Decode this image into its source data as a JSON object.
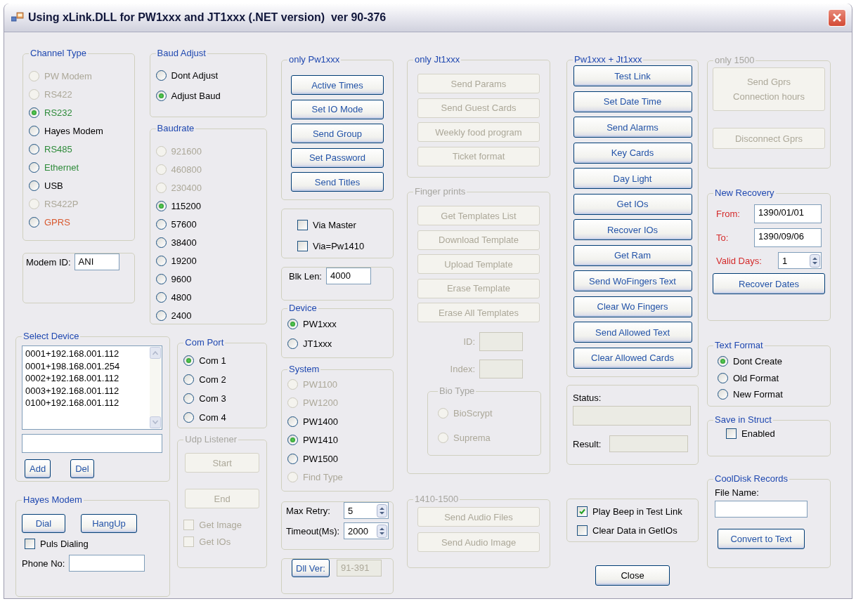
{
  "window": {
    "title": "Using xLink.DLL for PW1xxx and JT1xxx (.NET version)  ver 90-376"
  },
  "channel_type": {
    "title": "Channel Type",
    "options": [
      {
        "label": "PW Modem",
        "selected": false,
        "disabled": true
      },
      {
        "label": "RS422",
        "selected": false,
        "disabled": true
      },
      {
        "label": "RS232",
        "selected": true,
        "disabled": false,
        "color": "#2e8b3a"
      },
      {
        "label": "Hayes Modem",
        "selected": false,
        "disabled": false,
        "color": "#000000"
      },
      {
        "label": "RS485",
        "selected": false,
        "disabled": false,
        "color": "#2e8b3a"
      },
      {
        "label": "Ethernet",
        "selected": false,
        "disabled": false,
        "color": "#2e8b3a"
      },
      {
        "label": "USB",
        "selected": false,
        "disabled": false,
        "color": "#000000"
      },
      {
        "label": "RS422P",
        "selected": false,
        "disabled": true
      },
      {
        "label": "GPRS",
        "selected": false,
        "disabled": false,
        "color": "#d8582e"
      }
    ]
  },
  "modem_id": {
    "label": "Modem ID:",
    "value": "ANI"
  },
  "baud_adjust": {
    "title": "Baud Adjust",
    "options": [
      {
        "label": "Dont Adjust",
        "selected": false
      },
      {
        "label": "Adjust Baud",
        "selected": true
      }
    ]
  },
  "baudrate": {
    "title": "Baudrate",
    "options": [
      {
        "label": "921600",
        "selected": false,
        "disabled": true
      },
      {
        "label": "460800",
        "selected": false,
        "disabled": true
      },
      {
        "label": "230400",
        "selected": false,
        "disabled": true
      },
      {
        "label": "115200",
        "selected": true,
        "disabled": false
      },
      {
        "label": "57600",
        "selected": false,
        "disabled": false
      },
      {
        "label": "38400",
        "selected": false,
        "disabled": false
      },
      {
        "label": "19200",
        "selected": false,
        "disabled": false
      },
      {
        "label": "9600",
        "selected": false,
        "disabled": false
      },
      {
        "label": "4800",
        "selected": false,
        "disabled": false
      },
      {
        "label": "2400",
        "selected": false,
        "disabled": false
      }
    ]
  },
  "select_device": {
    "title": "Select Device",
    "items": [
      "0001+192.168.001.112",
      "0001+198.168.001.254",
      "0002+192.168.001.112",
      "0003+192.168.001.112",
      "0100+192.168.001.112"
    ],
    "buttons": [
      {
        "label": "Add",
        "disabled": false
      },
      {
        "label": "Del",
        "disabled": false
      }
    ]
  },
  "hayes_modem": {
    "title": "Hayes Modem",
    "buttons": [
      {
        "label": "Dial",
        "disabled": false
      },
      {
        "label": "HangUp",
        "disabled": false
      }
    ],
    "puls_dialing": {
      "label": "Puls Dialing",
      "checked": false
    },
    "phone_no": {
      "label": "Phone No:"
    }
  },
  "com_port": {
    "title": "Com Port",
    "options": [
      {
        "label": "Com 1",
        "selected": true
      },
      {
        "label": "Com 2",
        "selected": false
      },
      {
        "label": "Com 3",
        "selected": false
      },
      {
        "label": "Com 4",
        "selected": false
      }
    ]
  },
  "udp_listener": {
    "title": "Udp Listener",
    "disabled": true,
    "buttons": [
      {
        "label": "Start",
        "disabled": true
      },
      {
        "label": "End",
        "disabled": true
      }
    ],
    "checkboxes": [
      {
        "label": "Get Image",
        "checked": false,
        "disabled": true
      },
      {
        "label": "Get IOs",
        "checked": false,
        "disabled": true
      }
    ]
  },
  "only_pw1xxx": {
    "title": "only Pw1xxx",
    "buttons": [
      {
        "label": "Active Times",
        "disabled": false
      },
      {
        "label": "Set IO Mode",
        "disabled": false
      },
      {
        "label": "Send Group",
        "disabled": false
      },
      {
        "label": "Set Password",
        "disabled": false
      },
      {
        "label": "Send Titles",
        "disabled": false
      }
    ]
  },
  "via": {
    "checkboxes": [
      {
        "label": "Via Master",
        "checked": false
      },
      {
        "label": "Via=Pw1410",
        "checked": false
      }
    ]
  },
  "blk_len": {
    "label": "Blk Len:",
    "value": "4000"
  },
  "device": {
    "title": "Device",
    "options": [
      {
        "label": "PW1xxx",
        "selected": true
      },
      {
        "label": "JT1xxx",
        "selected": false
      }
    ]
  },
  "system": {
    "title": "System",
    "options": [
      {
        "label": "PW1100",
        "selected": false,
        "disabled": true
      },
      {
        "label": "PW1200",
        "selected": false,
        "disabled": true
      },
      {
        "label": "PW1400",
        "selected": false,
        "disabled": false
      },
      {
        "label": "PW1410",
        "selected": true,
        "disabled": false
      },
      {
        "label": "PW1500",
        "selected": false,
        "disabled": false
      },
      {
        "label": "Find Type",
        "selected": false,
        "disabled": true
      }
    ]
  },
  "retry": {
    "fields": [
      {
        "label": "Max Retry:",
        "value": "5"
      },
      {
        "label": "Timeout(Ms):",
        "value": "2000"
      }
    ]
  },
  "dll_ver": {
    "button": {
      "label": "Dll Ver:",
      "disabled": false
    },
    "value": "91-391"
  },
  "only_jt1xxx": {
    "title": "only Jt1xxx",
    "buttons": [
      {
        "label": "Send Params",
        "disabled": true
      },
      {
        "label": "Send Guest Cards",
        "disabled": true
      },
      {
        "label": "Weekly food program",
        "disabled": true
      },
      {
        "label": "Ticket format",
        "disabled": true
      }
    ]
  },
  "finger_prints": {
    "title": "Finger prints",
    "disabled": true,
    "buttons": [
      {
        "label": "Get Templates List",
        "disabled": true
      },
      {
        "label": "Download Template",
        "disabled": true
      },
      {
        "label": "Upload Template",
        "disabled": true
      },
      {
        "label": "Erase Template",
        "disabled": true
      },
      {
        "label": "Erase All Templates",
        "disabled": true
      }
    ],
    "fields": [
      {
        "label": "ID:"
      },
      {
        "label": "Index:"
      }
    ],
    "bio_type": {
      "title": "Bio Type",
      "disabled": true,
      "options": [
        {
          "label": "BioScrypt",
          "selected": false,
          "disabled": true
        },
        {
          "label": "Suprema",
          "selected": false,
          "disabled": true
        }
      ]
    }
  },
  "audio_1410_1500": {
    "title": "1410-1500",
    "disabled": true,
    "buttons": [
      {
        "label": "Send Audio Files",
        "disabled": true
      },
      {
        "label": "Send Audio Image",
        "disabled": true
      }
    ]
  },
  "pw_jt": {
    "title": "Pw1xxx + Jt1xxx",
    "buttons": [
      {
        "label": "Test Link",
        "disabled": false
      },
      {
        "label": "Set Date Time",
        "disabled": false
      },
      {
        "label": "Send Alarms",
        "disabled": false
      },
      {
        "label": "Key Cards",
        "disabled": false
      },
      {
        "label": "Day Light",
        "disabled": false
      },
      {
        "label": "Get IOs",
        "disabled": false
      },
      {
        "label": "Recover IOs",
        "disabled": false
      },
      {
        "label": "Get Ram",
        "disabled": false
      },
      {
        "label": "Send WoFingers Text",
        "disabled": false
      },
      {
        "label": "Clear Wo Fingers",
        "disabled": false
      },
      {
        "label": "Send Allowed Text",
        "disabled": false
      },
      {
        "label": "Clear Allowed Cards",
        "disabled": false
      }
    ]
  },
  "status": {
    "status_label": "Status:",
    "result_label": "Result:"
  },
  "options": {
    "checkboxes": [
      {
        "label": "Play Beep in Test Link",
        "checked": true
      },
      {
        "label": "Clear Data in GetIOs",
        "checked": false
      }
    ]
  },
  "close_button": {
    "label": "Close",
    "disabled": false
  },
  "only_1500": {
    "title": "only 1500",
    "disabled": true,
    "buttons": [
      {
        "label": "Send Gprs\nConnection hours",
        "disabled": true
      },
      {
        "label": "Disconnect Gprs",
        "disabled": true
      }
    ]
  },
  "new_recovery": {
    "title": "New Recovery",
    "from": {
      "label": "From:",
      "value": "1390/01/01"
    },
    "to": {
      "label": "To:",
      "value": "1390/09/06"
    },
    "valid_days": {
      "label": "Valid Days:",
      "value": "1"
    },
    "button": {
      "label": "Recover Dates",
      "disabled": false
    }
  },
  "text_format": {
    "title": "Text Format",
    "options": [
      {
        "label": "Dont Create",
        "selected": true
      },
      {
        "label": "Old Format",
        "selected": false
      },
      {
        "label": "New Format",
        "selected": false
      }
    ]
  },
  "save_in_struct": {
    "title": "Save in Struct",
    "checkbox": {
      "label": "Enabled",
      "checked": false
    }
  },
  "cooldisk": {
    "title": "CoolDisk Records",
    "file_name": {
      "label": "File Name:"
    },
    "button": {
      "label": "Convert to Text",
      "disabled": false
    }
  }
}
